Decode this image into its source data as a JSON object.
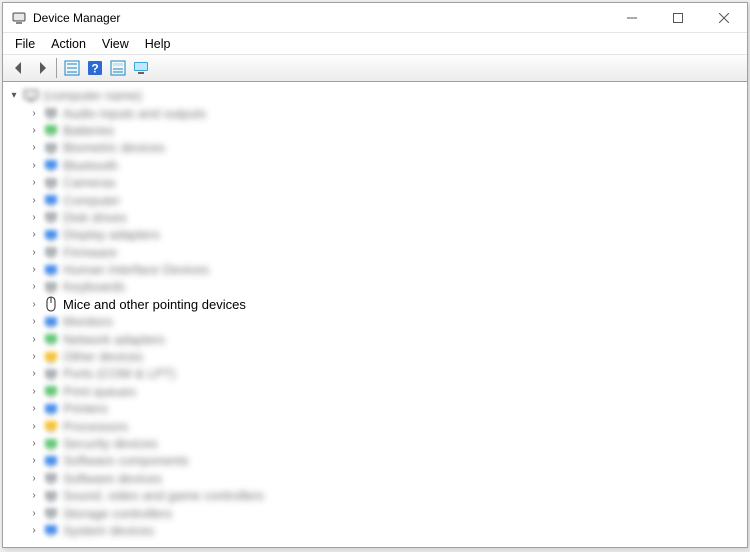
{
  "window": {
    "title": "Device Manager"
  },
  "menus": [
    "File",
    "Action",
    "View",
    "Help"
  ],
  "toolbar_icons": [
    "back",
    "forward",
    "|",
    "show-hidden",
    "help",
    "properties",
    "scan-hardware"
  ],
  "tree": {
    "root": "(computer name)",
    "focused_item": "Mice and other pointing devices",
    "blurred_items": [
      "Audio inputs and outputs",
      "Batteries",
      "Biometric devices",
      "Bluetooth",
      "Cameras",
      "Computer",
      "Disk drives",
      "Display adapters",
      "Firmware",
      "Human Interface Devices",
      "Keyboards"
    ],
    "blurred_items_after": [
      "Monitors",
      "Network adapters",
      "Other devices",
      "Ports (COM & LPT)",
      "Print queues",
      "Printers",
      "Processors",
      "Security devices",
      "Software components",
      "Software devices",
      "Sound, video and game controllers",
      "Storage controllers",
      "System devices"
    ]
  }
}
